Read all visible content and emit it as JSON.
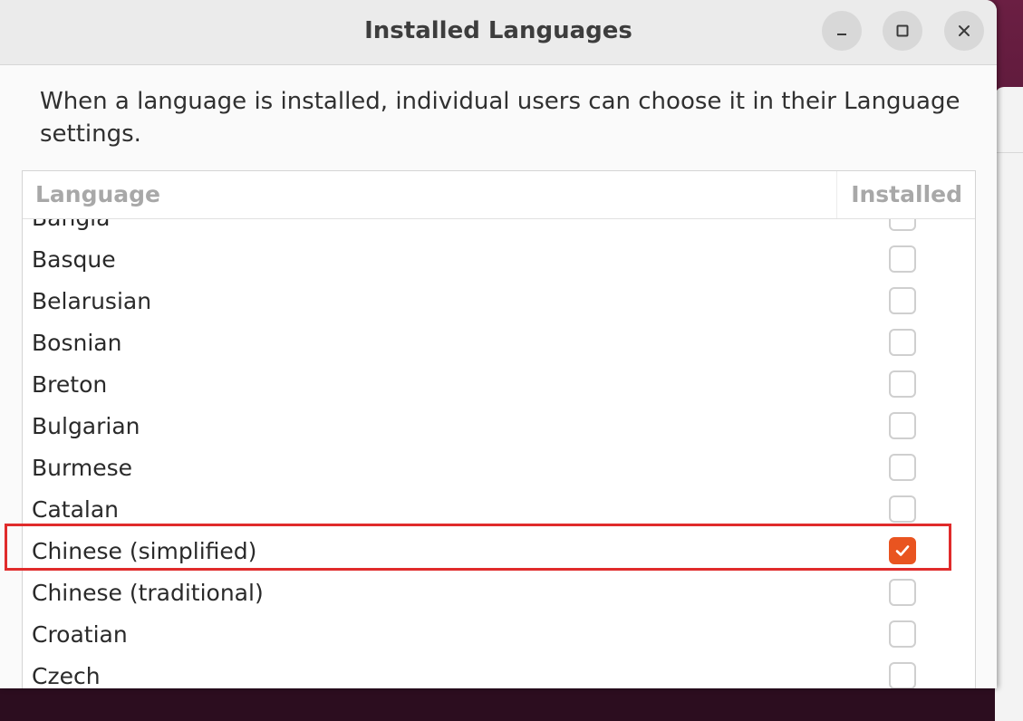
{
  "dialog": {
    "title": "Installed Languages",
    "description": "When a language is installed, individual users can choose it in their Language settings."
  },
  "window_controls": {
    "minimize_icon": "minimize-icon",
    "maximize_icon": "maximize-icon",
    "close_icon": "close-icon"
  },
  "table": {
    "columns": {
      "language": "Language",
      "installed": "Installed"
    },
    "rows": [
      {
        "name": "Bangla",
        "installed": false
      },
      {
        "name": "Basque",
        "installed": false
      },
      {
        "name": "Belarusian",
        "installed": false
      },
      {
        "name": "Bosnian",
        "installed": false
      },
      {
        "name": "Breton",
        "installed": false
      },
      {
        "name": "Bulgarian",
        "installed": false
      },
      {
        "name": "Burmese",
        "installed": false
      },
      {
        "name": "Catalan",
        "installed": false
      },
      {
        "name": "Chinese (simplified)",
        "installed": true,
        "highlighted": true
      },
      {
        "name": "Chinese (traditional)",
        "installed": false
      },
      {
        "name": "Croatian",
        "installed": false
      },
      {
        "name": "Czech",
        "installed": false
      }
    ]
  },
  "colors": {
    "accent": "#e95420",
    "highlight_outline": "#e02b2b",
    "desktop_background": "#4a1230"
  }
}
